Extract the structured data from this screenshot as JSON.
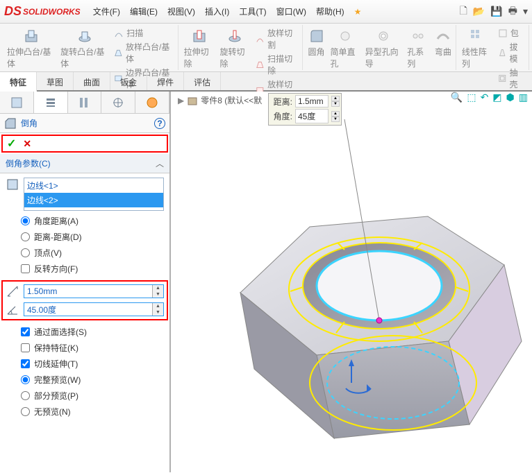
{
  "app": {
    "name": "SOLIDWORKS"
  },
  "menu": [
    "文件(F)",
    "编辑(E)",
    "视图(V)",
    "插入(I)",
    "工具(T)",
    "窗口(W)",
    "帮助(H)"
  ],
  "ribbon": {
    "g1a": "拉伸凸台/基体",
    "g1b": "旋转凸台/基体",
    "g1s1": "扫描",
    "g1s2": "放样凸台/基体",
    "g1s3": "边界凸台/基体",
    "g2a": "拉伸切除",
    "g2b": "旋转切除",
    "g2s1": "放样切割",
    "g2s2": "扫描切除",
    "g2s3": "放样切割",
    "g3a": "圆角",
    "g3b1": "简单直孔",
    "g3b2": "异型孔向导",
    "g3b3": "孔系列",
    "g3c": "弯曲",
    "g4a": "线性阵列",
    "g4b1": "包",
    "g4b2": "拔模",
    "g4b3": "抽壳"
  },
  "tabs": [
    "特征",
    "草图",
    "曲面",
    "钣金",
    "焊件",
    "评估"
  ],
  "feature": {
    "title": "倒角",
    "section": "倒角参数(C)",
    "edges": [
      "边线<1>",
      "边线<2>"
    ],
    "opt_angdist": "角度距离(A)",
    "opt_distdist": "距离-距离(D)",
    "opt_vertex": "顶点(V)",
    "opt_flip": "反转方向(F)",
    "distance": "1.50mm",
    "angle": "45.00度",
    "chk_facesel": "通过面选择(S)",
    "chk_keep": "保持特征(K)",
    "chk_tangent": "切线延伸(T)",
    "opt_fullprev": "完整预览(W)",
    "opt_partprev": "部分预览(P)",
    "opt_noprev": "无预览(N)"
  },
  "crumb": {
    "part": "零件8  (默认<<默"
  },
  "callout": {
    "dist_lbl": "距离:",
    "dist_val": "1.5mm",
    "ang_lbl": "角度:",
    "ang_val": "45度"
  }
}
